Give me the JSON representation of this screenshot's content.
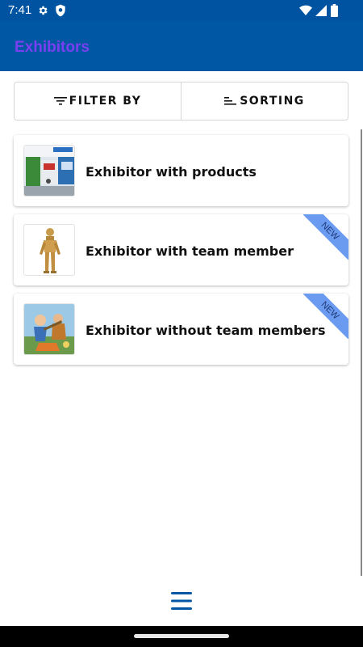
{
  "status_bar": {
    "time": "7:41",
    "icons": [
      "gear-icon",
      "shield-icon",
      "wifi-icon",
      "signal-icon",
      "battery-icon"
    ]
  },
  "app_bar": {
    "title": "Exhibitors"
  },
  "toolbar": {
    "filter_label": "FILTER BY",
    "sorting_label": "SORTING"
  },
  "exhibitors": [
    {
      "name": "Exhibitor with products",
      "badge": ""
    },
    {
      "name": "Exhibitor with team member",
      "badge": "NEW"
    },
    {
      "name": "Exhibitor without team members",
      "badge": "NEW"
    }
  ],
  "colors": {
    "primary": "#0057a3",
    "title": "#7a3ff0",
    "ribbon": "#6b9bf0",
    "menu_icon": "#0057a3"
  },
  "bottom_bar": {
    "icon": "hamburger-menu-icon"
  }
}
